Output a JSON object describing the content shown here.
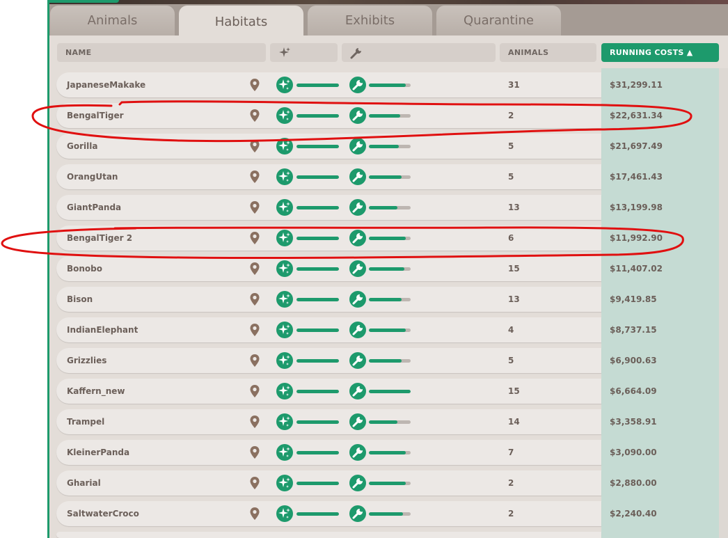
{
  "tabs": [
    {
      "label": "Animals",
      "active": false
    },
    {
      "label": "Habitats",
      "active": true
    },
    {
      "label": "Exhibits",
      "active": false
    },
    {
      "label": "Quarantine",
      "active": false
    }
  ],
  "columns": {
    "name": "NAME",
    "cleanliness_icon": "sparkle-icon",
    "maintenance_icon": "wrench-icon",
    "animals": "ANIMALS",
    "running_costs": "RUNNING COSTS ▲"
  },
  "colors": {
    "accent": "#1d9a6c",
    "row_bg": "#ece8e5",
    "text": "#6b5f59",
    "annotation": "#e01010"
  },
  "rows": [
    {
      "name": "JapaneseMakake",
      "cleanliness": 1.0,
      "maintenance": 0.88,
      "animals": "31",
      "cost": "$31,299.11"
    },
    {
      "name": "BengalTiger",
      "cleanliness": 1.0,
      "maintenance": 0.75,
      "animals": "2",
      "cost": "$22,631.34"
    },
    {
      "name": "Gorilla",
      "cleanliness": 1.0,
      "maintenance": 0.72,
      "animals": "5",
      "cost": "$21,697.49"
    },
    {
      "name": "OrangUtan",
      "cleanliness": 1.0,
      "maintenance": 0.78,
      "animals": "5",
      "cost": "$17,461.43"
    },
    {
      "name": "GiantPanda",
      "cleanliness": 1.0,
      "maintenance": 0.68,
      "animals": "13",
      "cost": "$13,199.98"
    },
    {
      "name": "BengalTiger 2",
      "cleanliness": 1.0,
      "maintenance": 0.88,
      "animals": "6",
      "cost": "$11,992.90"
    },
    {
      "name": "Bonobo",
      "cleanliness": 1.0,
      "maintenance": 0.85,
      "animals": "15",
      "cost": "$11,407.02"
    },
    {
      "name": "Bison",
      "cleanliness": 1.0,
      "maintenance": 0.78,
      "animals": "13",
      "cost": "$9,419.85"
    },
    {
      "name": "IndianElephant",
      "cleanliness": 1.0,
      "maintenance": 0.88,
      "animals": "4",
      "cost": "$8,737.15"
    },
    {
      "name": "Grizzlies",
      "cleanliness": 1.0,
      "maintenance": 0.78,
      "animals": "5",
      "cost": "$6,900.63"
    },
    {
      "name": "Kaffern_new",
      "cleanliness": 1.0,
      "maintenance": 1.0,
      "animals": "15",
      "cost": "$6,664.09"
    },
    {
      "name": "Trampel",
      "cleanliness": 1.0,
      "maintenance": 0.68,
      "animals": "14",
      "cost": "$3,358.91"
    },
    {
      "name": "KleinerPanda",
      "cleanliness": 1.0,
      "maintenance": 0.88,
      "animals": "7",
      "cost": "$3,090.00"
    },
    {
      "name": "Gharial",
      "cleanliness": 1.0,
      "maintenance": 0.88,
      "animals": "2",
      "cost": "$2,880.00"
    },
    {
      "name": "SaltwaterCroco",
      "cleanliness": 1.0,
      "maintenance": 0.82,
      "animals": "2",
      "cost": "$2,240.40"
    }
  ],
  "highlighted_rows": [
    "BengalTiger",
    "BengalTiger 2"
  ]
}
